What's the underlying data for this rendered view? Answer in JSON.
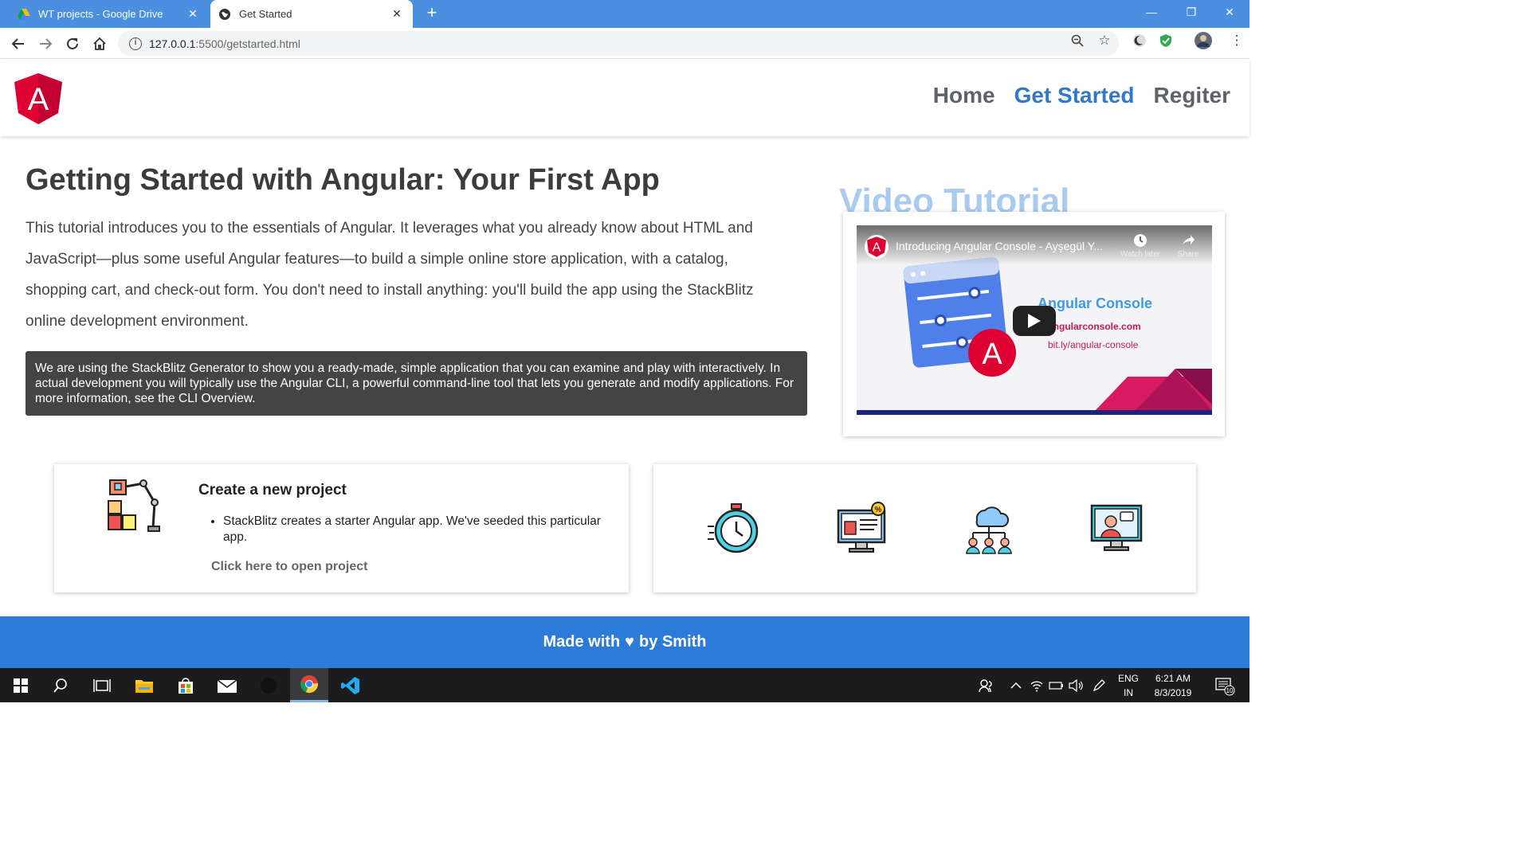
{
  "browser": {
    "tabs": [
      {
        "label": "WT projects - Google Drive",
        "active": false
      },
      {
        "label": "Get Started",
        "active": true
      }
    ],
    "url_host": "127.0.0.1",
    "url_rest": ":5500/getstarted.html"
  },
  "site": {
    "nav": [
      {
        "label": "Home",
        "active": false
      },
      {
        "label": "Get Started",
        "active": true
      },
      {
        "label": "Regiter",
        "active": false
      }
    ],
    "logo_letter": "A",
    "accent_color": "#3178c6"
  },
  "main": {
    "title": "Getting Started with Angular: Your First App",
    "intro": "This tutorial introduces you to the essentials of Angular. It leverages what you already know about HTML and JavaScript—plus some useful Angular features—to build a simple online store application, with a catalog, shopping cart, and check-out form. You don't need to install anything: you'll build the app using the StackBlitz online development environment.",
    "note": "We are using the StackBlitz Generator to show you a ready-made, simple application that you can examine and play with interactively. In actual development you will typically use the Angular CLI, a powerful command-line tool that lets you generate and modify applications. For more information, see the CLI Overview."
  },
  "video": {
    "heading": "Video Tutorial",
    "title": "Introducing Angular Console - Ayşegül Y...",
    "watch_later": "Watch later",
    "share": "Share",
    "thumb_title": "Angular Console",
    "thumb_url": "angularconsole.com",
    "thumb_bitly": "bit.ly/angular-console"
  },
  "project_card": {
    "title": "Create a new project",
    "bullet": "StackBlitz creates a starter Angular app. We've seeded this particular app.",
    "link": "Click here to open project"
  },
  "feature_icons": [
    "stopwatch-icon",
    "online-shop-icon",
    "cloud-network-icon",
    "video-call-icon"
  ],
  "footer": {
    "before": "Made with",
    "heart": "♥",
    "after": "by Smith"
  },
  "taskbar": {
    "lang_line1": "ENG",
    "lang_line2": "IN",
    "time": "6:21 AM",
    "date": "8/3/2019",
    "notifications": "10"
  }
}
